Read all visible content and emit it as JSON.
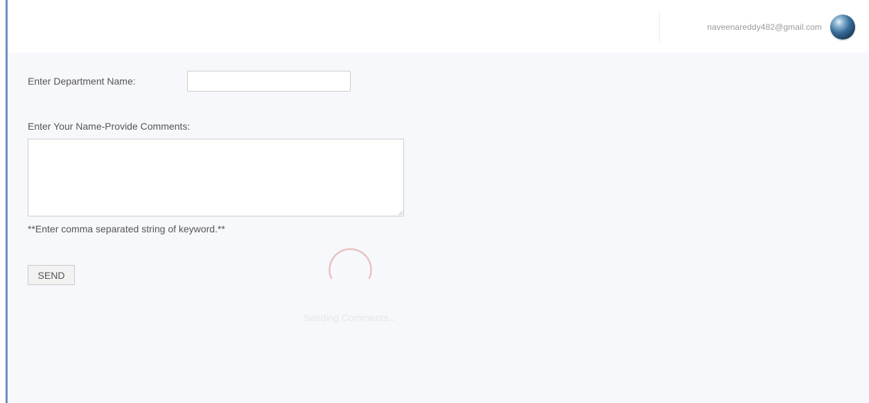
{
  "header": {
    "user_email": "naveenareddy482@gmail.com",
    "avatar_icon": "globe-avatar"
  },
  "form": {
    "department_label": "Enter Department Name:",
    "department_value": "",
    "comments_label": "Enter Your Name-Provide Comments:",
    "comments_value": "",
    "hint": "**Enter comma separated string of keyword.**",
    "send_label": "SEND"
  },
  "loader": {
    "icon": "spinner-icon",
    "message": "Sending Comments..."
  },
  "colors": {
    "accent_bar": "#6f8dc2",
    "spinner": "#e7c3c3"
  }
}
